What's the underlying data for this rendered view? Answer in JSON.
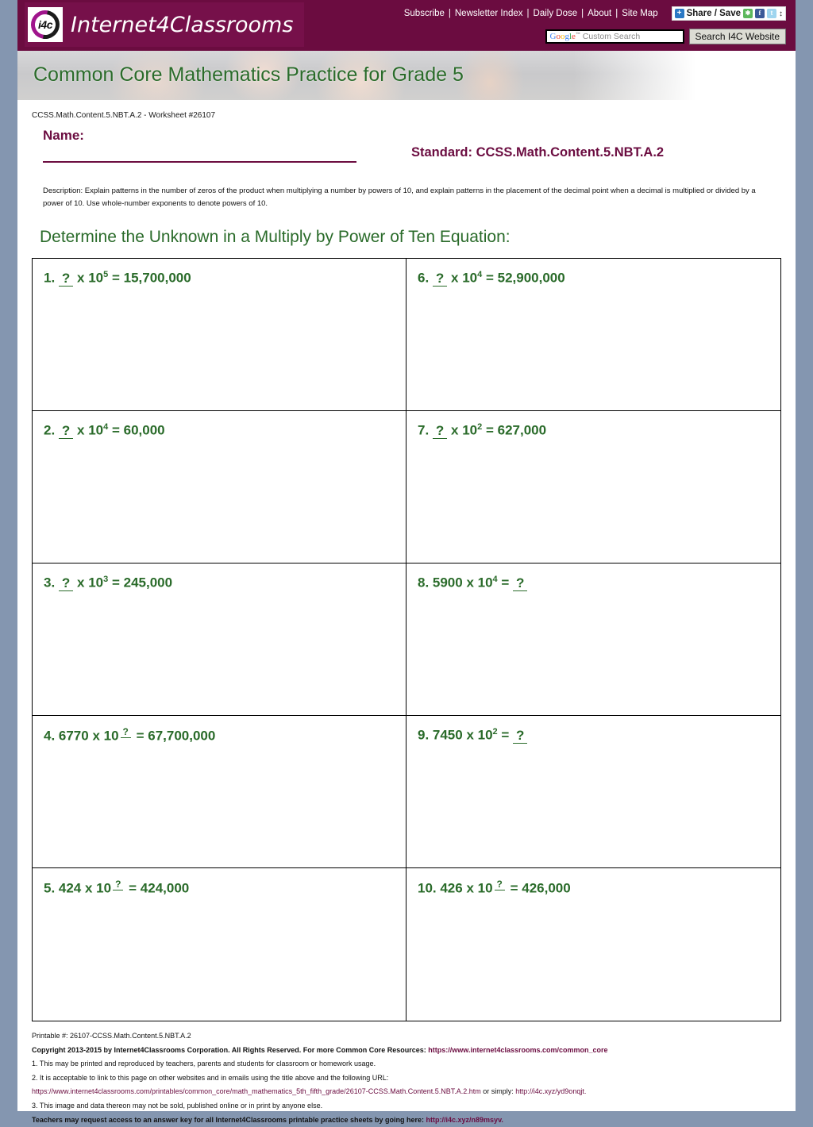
{
  "site": {
    "logo_text": "Internet4Classrooms",
    "logo_badge": "i4c",
    "nav": [
      {
        "label": "Subscribe"
      },
      {
        "label": "Newsletter Index"
      },
      {
        "label": "Daily Dose"
      },
      {
        "label": "About"
      },
      {
        "label": "Site Map"
      }
    ],
    "share": {
      "label": "Share / Save",
      "plus": "+",
      "arrows": "↕"
    },
    "search": {
      "google_g": "G",
      "google_o1": "o",
      "google_o2": "o",
      "google_g2": "g",
      "google_l": "l",
      "google_e": "e",
      "tm": "™",
      "placeholder": "Custom Search",
      "button_label": "Search I4C Website"
    }
  },
  "banner": {
    "title": "Common Core Mathematics Practice for Grade 5"
  },
  "worksheet": {
    "id_line": "CCSS.Math.Content.5.NBT.A.2 - Worksheet #26107",
    "name_label": "Name:",
    "standard_label": "Standard: CCSS.Math.Content.5.NBT.A.2",
    "description": "Description: Explain patterns in the number of zeros of the product when multiplying a number by powers of 10, and explain patterns in the placement of the decimal point when a decimal is multiplied or divided by a power of 10. Use whole-number exponents to denote powers of 10.",
    "instruction": "Determine the Unknown in a Multiply by Power of Ten Equation:"
  },
  "problems": [
    {
      "num": "1.",
      "a": "",
      "q_base": true,
      "x": "x",
      "base": "10",
      "exp": "5",
      "q_exp": false,
      "eq": "=",
      "result": "15,700,000"
    },
    {
      "num": "6.",
      "a": "",
      "q_base": true,
      "x": "x",
      "base": "10",
      "exp": "4",
      "q_exp": false,
      "eq": "=",
      "result": "52,900,000"
    },
    {
      "num": "2.",
      "a": "",
      "q_base": true,
      "x": "x",
      "base": "10",
      "exp": "4",
      "q_exp": false,
      "eq": "=",
      "result": "60,000"
    },
    {
      "num": "7.",
      "a": "",
      "q_base": true,
      "x": "x",
      "base": "10",
      "exp": "2",
      "q_exp": false,
      "eq": "=",
      "result": "627,000"
    },
    {
      "num": "3.",
      "a": "",
      "q_base": true,
      "x": "x",
      "base": "10",
      "exp": "3",
      "q_exp": false,
      "eq": "=",
      "result": "245,000"
    },
    {
      "num": "8.",
      "a": "5900",
      "q_base": false,
      "x": "x",
      "base": "10",
      "exp": "4",
      "q_exp": false,
      "eq": "=",
      "result": "?"
    },
    {
      "num": "4.",
      "a": "6770",
      "q_base": false,
      "x": "x",
      "base": "10",
      "exp": "?",
      "q_exp": true,
      "eq": "=",
      "result": "67,700,000"
    },
    {
      "num": "9.",
      "a": "7450",
      "q_base": false,
      "x": "x",
      "base": "10",
      "exp": "2",
      "q_exp": false,
      "eq": "=",
      "result": "?"
    },
    {
      "num": "5.",
      "a": "424",
      "q_base": false,
      "x": "x",
      "base": "10",
      "exp": "?",
      "q_exp": true,
      "eq": "=",
      "result": "424,000"
    },
    {
      "num": "10.",
      "a": "426",
      "q_base": false,
      "x": "x",
      "base": "10",
      "exp": "?",
      "q_exp": true,
      "eq": "=",
      "result": "426,000"
    }
  ],
  "problem_text": {
    "p1": "1.  ?  x 10⁵ = 15,700,000",
    "p2": "2.  ?  x 10⁴ = 60,000",
    "p3": "3.  ?  x 10³ = 245,000",
    "p4": "4. 6770 x 10 ᴾ = 67,700,000",
    "p5": "5. 424 x 10 ᴾ = 424,000",
    "p6": "6.  ?  x 10⁴ = 52,900,000",
    "p7": "7.  ?  x 10² = 627,000",
    "p8": "8. 5900 x 10⁴ =  ? ",
    "p9": "9. 7450 x 10² =  ? ",
    "p10": "10. 426 x 10 ᴾ = 426,000"
  },
  "footer": {
    "printable": "Printable #: 26107-CCSS.Math.Content.5.NBT.A.2",
    "copyright_pre": "Copyright 2013-2015 by Internet4Classrooms Corporation. All Rights Reserved. For more Common Core Resources: ",
    "copyright_link": "https://www.internet4classrooms.com/common_core",
    "line1": "1. This may be printed and reproduced by teachers, parents and students for classroom or homework usage.",
    "line2": "2. It is acceptable to link to this page on other websites and in emails using the title above and the following URL:",
    "url_long": "https://www.internet4classrooms.com/printables/common_core/math_mathematics_5th_fifth_grade/26107-CCSS.Math.Content.5.NBT.A.2.htm",
    "url_mid": " or simply: ",
    "url_short": "http://i4c.xyz/yd9onqjt.",
    "line3": "3. This image and data thereon may not be sold, published online or in print by anyone else.",
    "answer_pre": "Teachers may request access to an answer key for all Internet4Classrooms printable practice sheets by going here: ",
    "answer_link": "http://i4c.xyz/n89msyv."
  },
  "colors": {
    "brand_maroon": "#6b0c40",
    "accent_green": "#2a6b2a",
    "page_bg": "#8496b0"
  }
}
